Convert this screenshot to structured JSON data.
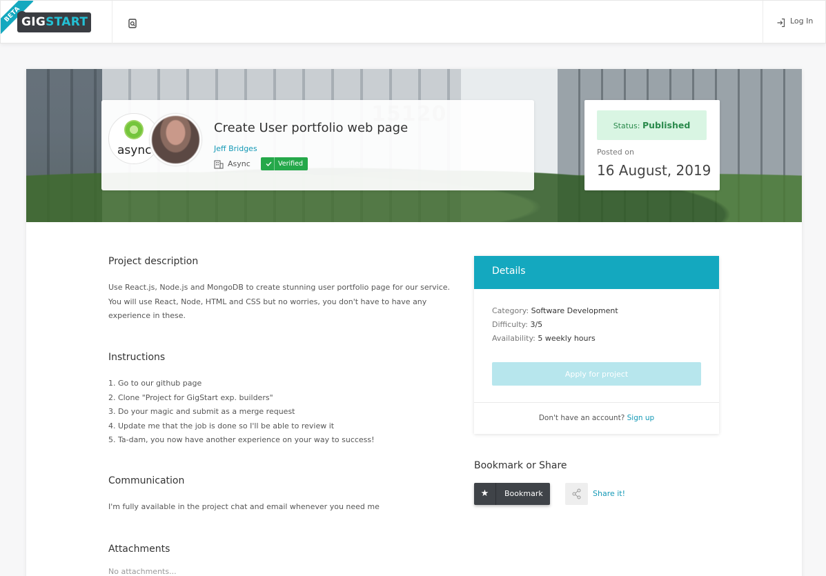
{
  "header": {
    "beta_label": "BETA",
    "logo_part1": "GIG",
    "logo_part2": "START",
    "login_label": "Log In"
  },
  "banner": {
    "building_number": "15120"
  },
  "project": {
    "title": "Create User portfolio web page",
    "owner": "Jeff Bridges",
    "company": "Async",
    "company_logo_text": "async",
    "verified_label": "Verified"
  },
  "status": {
    "label": "Status:",
    "value": "Published",
    "posted_label": "Posted on",
    "posted_date": "16 August, 2019"
  },
  "sections": {
    "description_title": "Project description",
    "description_lines": [
      "Use React.js, Node.js and MongoDB to create stunning user portfolio page for our service.",
      "You will use React, Node, HTML and CSS but no worries, you don't have to have any",
      "experience in these."
    ],
    "instructions_title": "Instructions",
    "instructions": [
      "1. Go to our github page",
      "2. Clone \"Project for GigStart exp. builders\"",
      "3. Do your magic and submit as a merge request",
      "4. Update me that the job is done so I'll be able to review it",
      "5. Ta-dam, you now have another experience on your way to success!"
    ],
    "communication_title": "Communication",
    "communication_text": "I'm fully available in the project chat and email whenever you need me",
    "attachments_title": "Attachments",
    "attachments_text": "No attachments..."
  },
  "details": {
    "title": "Details",
    "category_label": "Category:",
    "category_value": "Software Development",
    "difficulty_label": "Difficulty:",
    "difficulty_value": "3/5",
    "availability_label": "Availability:",
    "availability_value": "5 weekly hours",
    "apply_label": "Apply for project",
    "no_account_text": "Don't have an account?",
    "signup_label": "Sign up"
  },
  "share": {
    "title": "Bookmark or Share",
    "bookmark_label": "Bookmark",
    "share_label": "Share it!"
  },
  "colors": {
    "accent": "#14a8bf",
    "verified": "#25a84a",
    "status_bg": "#d9f5e3"
  }
}
